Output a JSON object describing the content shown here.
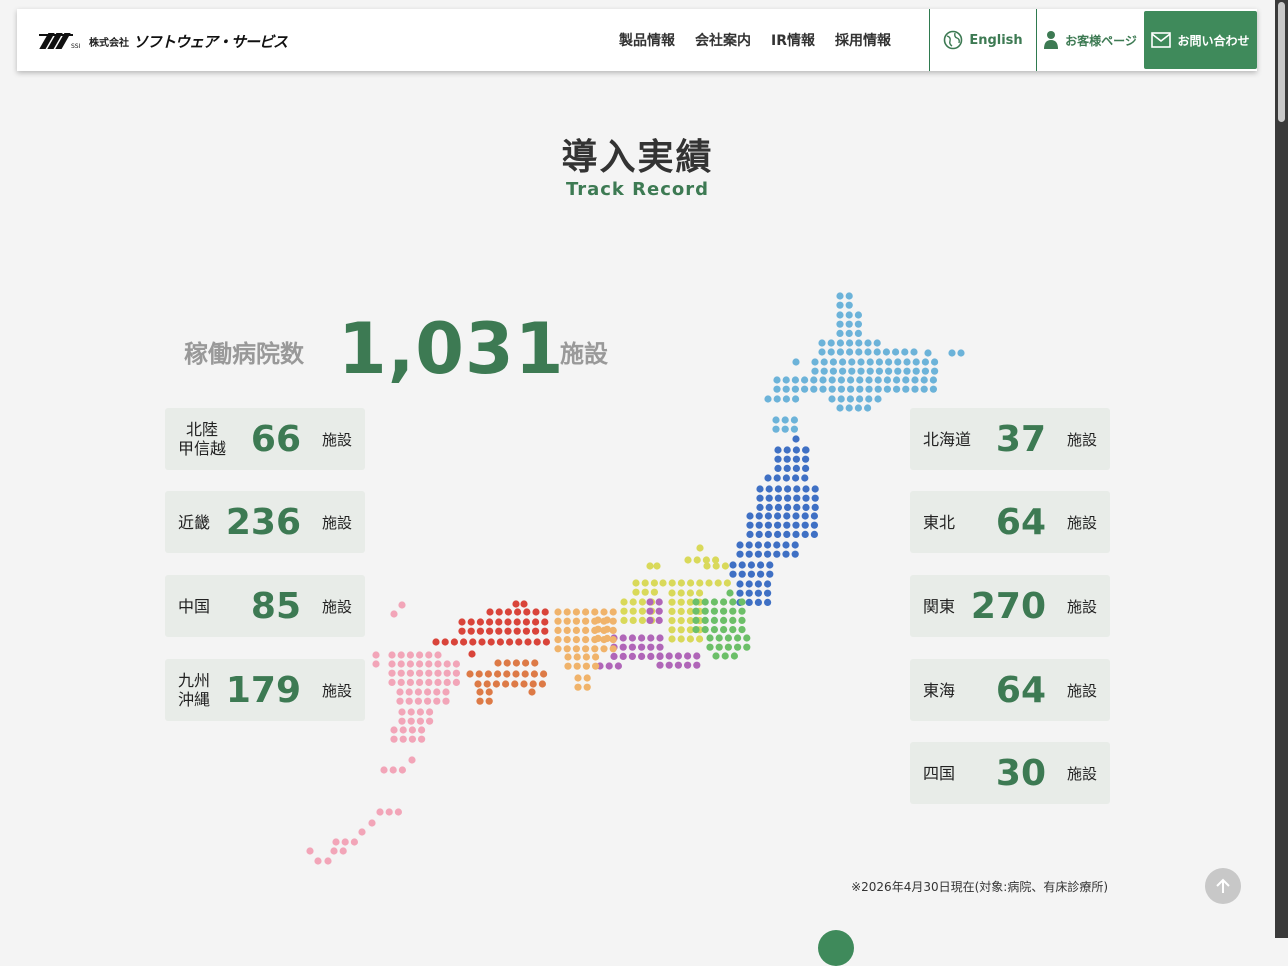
{
  "header": {
    "logo_ja": "株式会社",
    "logo_name": "ソフトウェア・サービス",
    "nav": [
      "製品情報",
      "会社案内",
      "IR情報",
      "採用情報"
    ],
    "english_label": "English",
    "customer_label": "お客様ページ",
    "contact_label": "お問い合わせ",
    "accent_color": "#3f8a5b"
  },
  "section": {
    "title": "導入実績",
    "subtitle": "Track Record"
  },
  "total": {
    "label": "稼働病院数",
    "value": "1,031",
    "unit": "施設"
  },
  "regions_left": [
    {
      "name": "北陸\n甲信越",
      "value": "66",
      "unit": "施設"
    },
    {
      "name": "近畿",
      "value": "236",
      "unit": "施設"
    },
    {
      "name": "中国",
      "value": "85",
      "unit": "施設"
    },
    {
      "name": "九州\n沖縄",
      "value": "179",
      "unit": "施設"
    }
  ],
  "regions_right": [
    {
      "name": "北海道",
      "value": "37",
      "unit": "施設"
    },
    {
      "name": "東北",
      "value": "64",
      "unit": "施設"
    },
    {
      "name": "関東",
      "value": "270",
      "unit": "施設"
    },
    {
      "name": "東海",
      "value": "64",
      "unit": "施設"
    },
    {
      "name": "四国",
      "value": "30",
      "unit": "施設"
    }
  ],
  "map_colors": {
    "hokkaido": "#6cb3d9",
    "tohoku": "#3f70c4",
    "kanto": "#6cbf68",
    "hokuriku": "#d9d95a",
    "tokai": "#b066b8",
    "kinki": "#f0b36b",
    "chugoku": "#d9443a",
    "shikoku": "#dd7a46",
    "kyushu": "#f2a5b8"
  },
  "note": "※2026年4月30日現在(対象:病院、有床診療所)"
}
